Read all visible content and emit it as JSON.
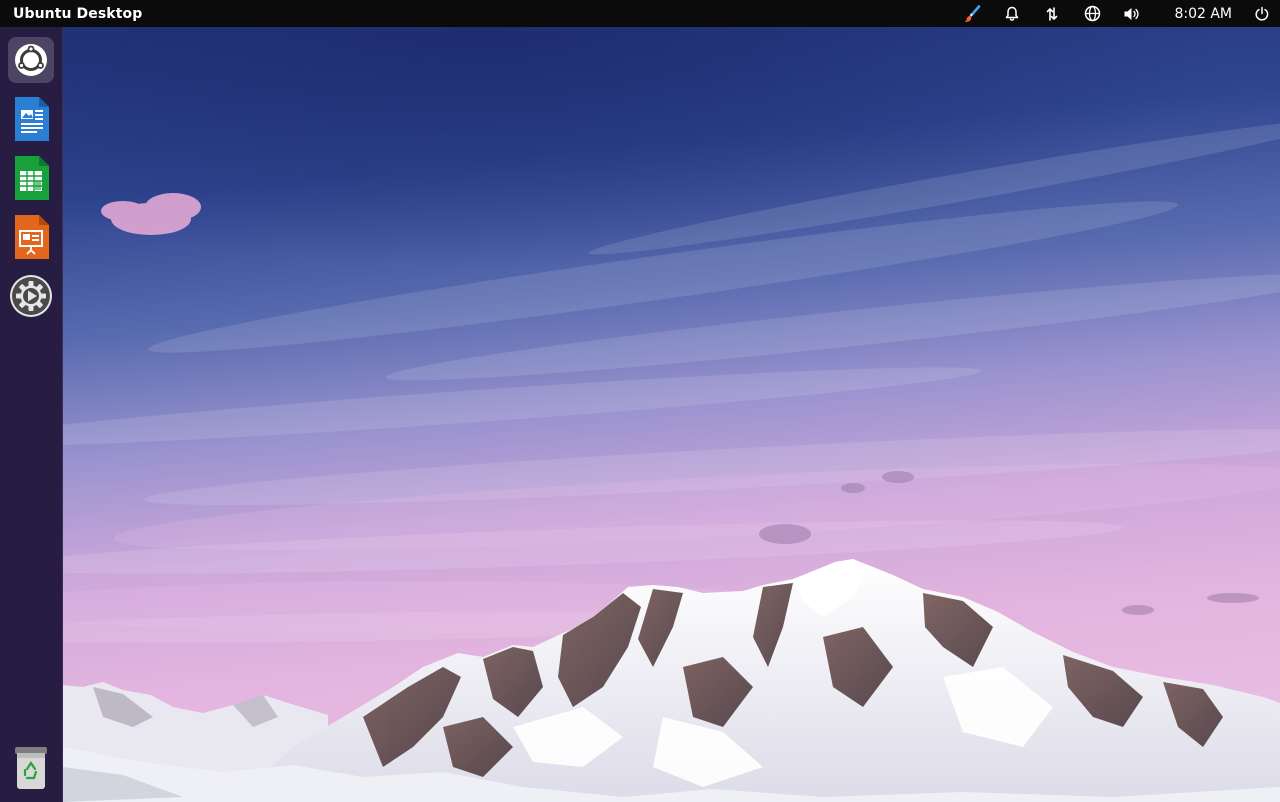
{
  "top_panel": {
    "activities_label": "Ubuntu Desktop",
    "clock": "8:02 AM",
    "tray_icons": [
      "paintbrush-icon",
      "bell-icon",
      "network-icon",
      "globe-icon",
      "volume-icon",
      "power-icon"
    ]
  },
  "dock": {
    "items": [
      {
        "name": "ubuntu-icon"
      },
      {
        "name": "libreoffice-writer-icon"
      },
      {
        "name": "libreoffice-calc-icon"
      },
      {
        "name": "libreoffice-impress-icon"
      },
      {
        "name": "settings-icon"
      },
      {
        "name": "trash-icon"
      }
    ]
  },
  "colors": {
    "panel": "#0b0b0b",
    "dock": "#271d42",
    "sky_top": "#2b3c7f",
    "sky_bottom": "#e5b6e0",
    "snow": "#f1f1f6"
  }
}
